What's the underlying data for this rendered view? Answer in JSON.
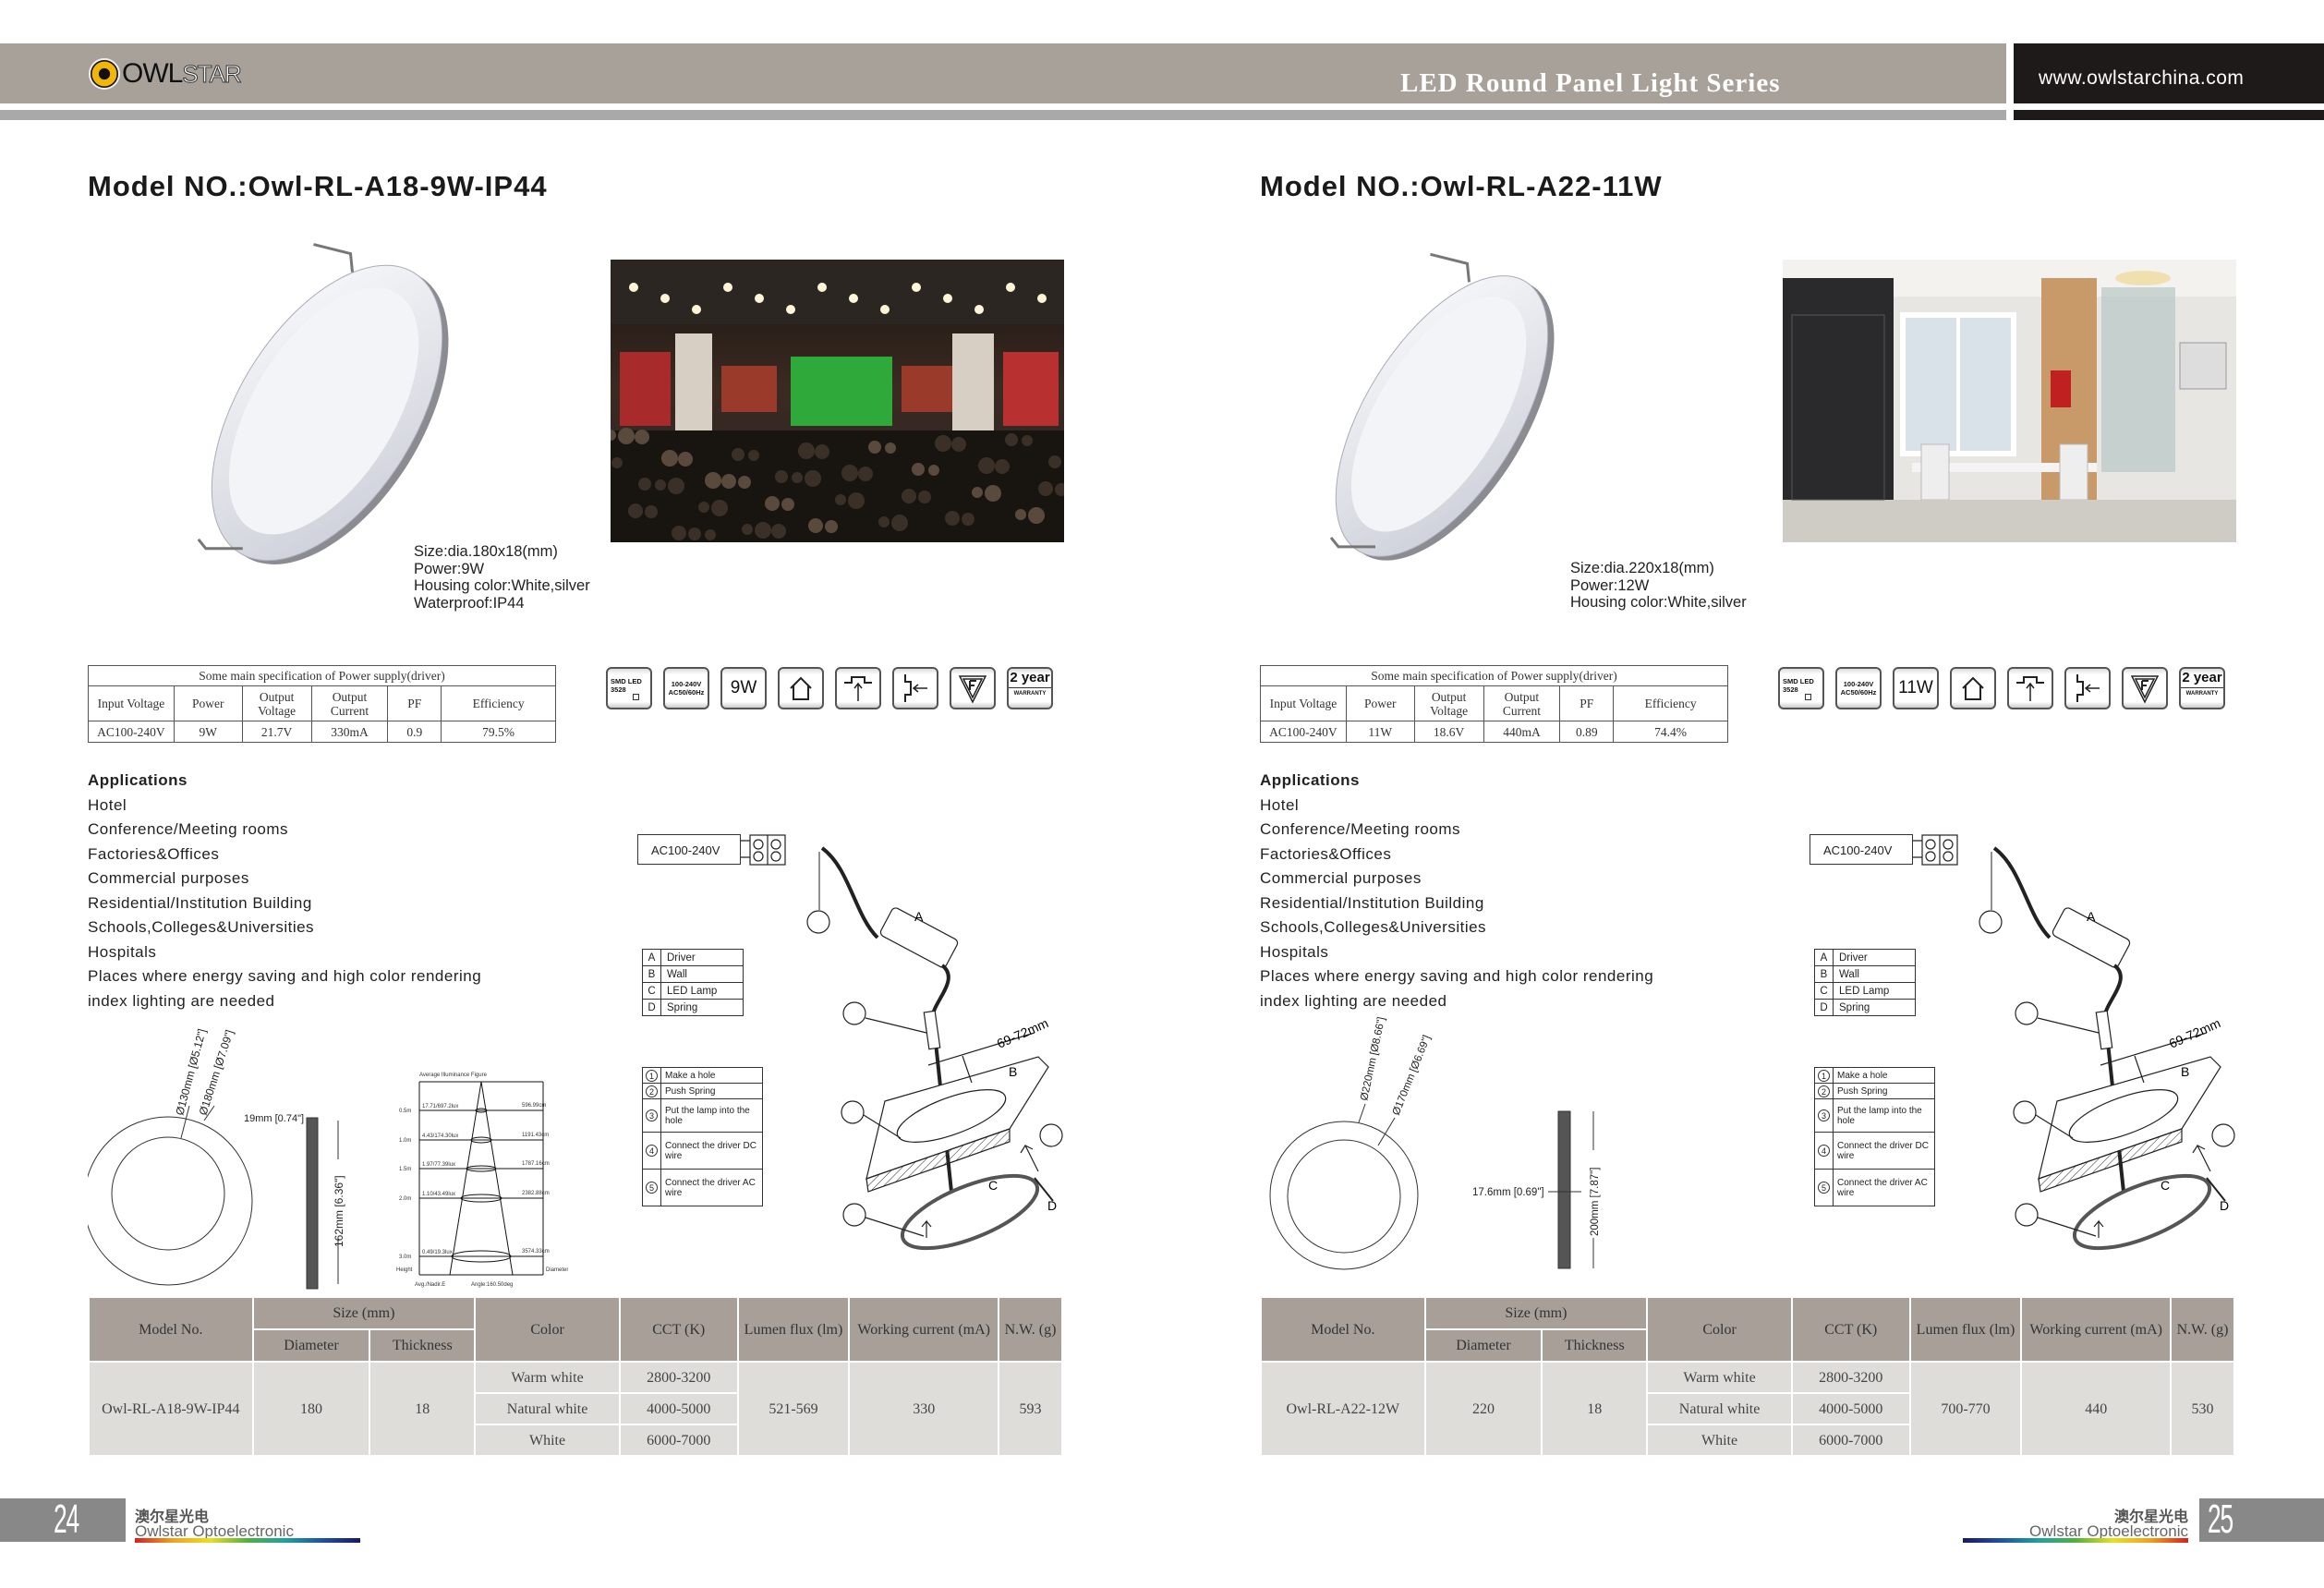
{
  "header": {
    "logo_text": "OWLSTAR",
    "logo_left": "OWL",
    "logo_right": "STAR",
    "series_title": "LED Round Panel Light Series",
    "website": "www.owlstarchina.com"
  },
  "icon_labels": {
    "smd": [
      "SMD LED",
      "3528"
    ],
    "voltage": [
      "100-240V",
      "AC50/60Hz"
    ],
    "warranty": [
      "2 year",
      "WARRANTY"
    ],
    "icon_names": [
      "smd-led-icon",
      "voltage-icon",
      "power-icon",
      "indoor-house-icon",
      "recessed-mount-icon",
      "side-insert-icon",
      "f-mark-icon",
      "warranty-icon"
    ]
  },
  "driver_table_labels": {
    "caption": "Some main specification of Power supply(driver)",
    "headers": [
      "Input Voltage",
      "Power",
      "Output Voltage",
      "Output Current",
      "PF",
      "Efficiency"
    ]
  },
  "applications": {
    "title": "Applications",
    "items": [
      "Hotel",
      "Conference/Meeting rooms",
      "Factories&Offices",
      "Commercial purposes",
      "Residential/Institution Building",
      "Schools,Colleges&Universities",
      "Hospitals",
      "Places where energy saving and high color rendering",
      "index lighting are needed"
    ]
  },
  "installation": {
    "ac_label": "AC100-240V",
    "parts": [
      {
        "key": "A",
        "label": "Driver"
      },
      {
        "key": "B",
        "label": "Wall"
      },
      {
        "key": "C",
        "label": "LED Lamp"
      },
      {
        "key": "D",
        "label": "Spring"
      }
    ],
    "steps": [
      {
        "num": "1",
        "label": "Make a hole"
      },
      {
        "num": "2",
        "label": "Push Spring"
      },
      {
        "num": "3",
        "label": "Put the lamp into the hole"
      },
      {
        "num": "4",
        "label": "Connect the driver DC wire"
      },
      {
        "num": "5",
        "label": "Connect the driver AC wire"
      }
    ],
    "cutout": "69-72mm",
    "callout_letters": [
      "A",
      "B",
      "C",
      "D"
    ],
    "callout_numbers": [
      "1",
      "2",
      "3",
      "4",
      "5"
    ]
  },
  "product_table_labels": {
    "model": "Model No.",
    "size": "Size (mm)",
    "diameter": "Diameter",
    "thickness": "Thickness",
    "color": "Color",
    "cct": "CCT (K)",
    "lumen": "Lumen flux (lm)",
    "current": "Working current (mA)",
    "nw": "N.W. (g)",
    "colors": [
      "Warm white",
      "Natural white",
      "White"
    ],
    "ccts": [
      "2800-3200",
      "4000-5000",
      "6000-7000"
    ]
  },
  "footer": {
    "cn": "澳尔星光电",
    "en": "Owlstar Optoelectronic"
  },
  "pages": [
    {
      "page_number": "24",
      "model_title": "Model NO.:Owl-RL-A18-9W-IP44",
      "specs": [
        "Size:dia.180x18(mm)",
        "Power:9W",
        "Housing color:White,silver",
        "Waterproof:IP44"
      ],
      "driver_row": [
        "AC100-240V",
        "9W",
        "21.7V",
        "330mA",
        "0.9",
        "79.5%"
      ],
      "power_icon": "9W",
      "dimensions": {
        "inner": "Ø130mm [Ø5.12\"]",
        "outer": "Ø180mm [Ø7.09\"]",
        "thickness": "19mm [0.74\"]",
        "height": "162mm [6.36\"]"
      },
      "illuminance": {
        "title": "Average Illuminance Figure",
        "heights": [
          "0.5m",
          "1.0m",
          "1.5m",
          "2.0m",
          "3.0m"
        ],
        "lux": [
          "17.71/697.2lux",
          "4.43/174.30lux",
          "1.97/77.39lux",
          "1.10/43.49lux",
          "0.49/19.3lux"
        ],
        "diameters": [
          "596.99cm",
          "1191.43cm",
          "1787.16cm",
          "2382.88cm",
          "3574.33cm"
        ],
        "height_label": "Height",
        "diameter_label": "Diameter",
        "avg_label": "Avg./Nadir.E",
        "angle_label": "Angle:160.50deg"
      },
      "product_row": {
        "model": "Owl-RL-A18-9W-IP44",
        "diameter": "180",
        "thickness": "18",
        "lumen": "521-569",
        "current": "330",
        "nw": "593"
      }
    },
    {
      "page_number": "25",
      "model_title": "Model NO.:Owl-RL-A22-11W",
      "specs": [
        "Size:dia.220x18(mm)",
        "Power:12W",
        "Housing color:White,silver"
      ],
      "driver_row": [
        "AC100-240V",
        "11W",
        "18.6V",
        "440mA",
        "0.89",
        "74.4%"
      ],
      "power_icon": "11W",
      "dimensions": {
        "outer": "Ø220mm [Ø8.66\"]",
        "inner": "Ø170mm [Ø6.69\"]",
        "thickness": "17.6mm [0.69\"]",
        "height": "200mm [7.87\"]"
      },
      "product_row": {
        "model": "Owl-RL-A22-12W",
        "diameter": "220",
        "thickness": "18",
        "lumen": "700-770",
        "current": "440",
        "nw": "530"
      }
    }
  ]
}
